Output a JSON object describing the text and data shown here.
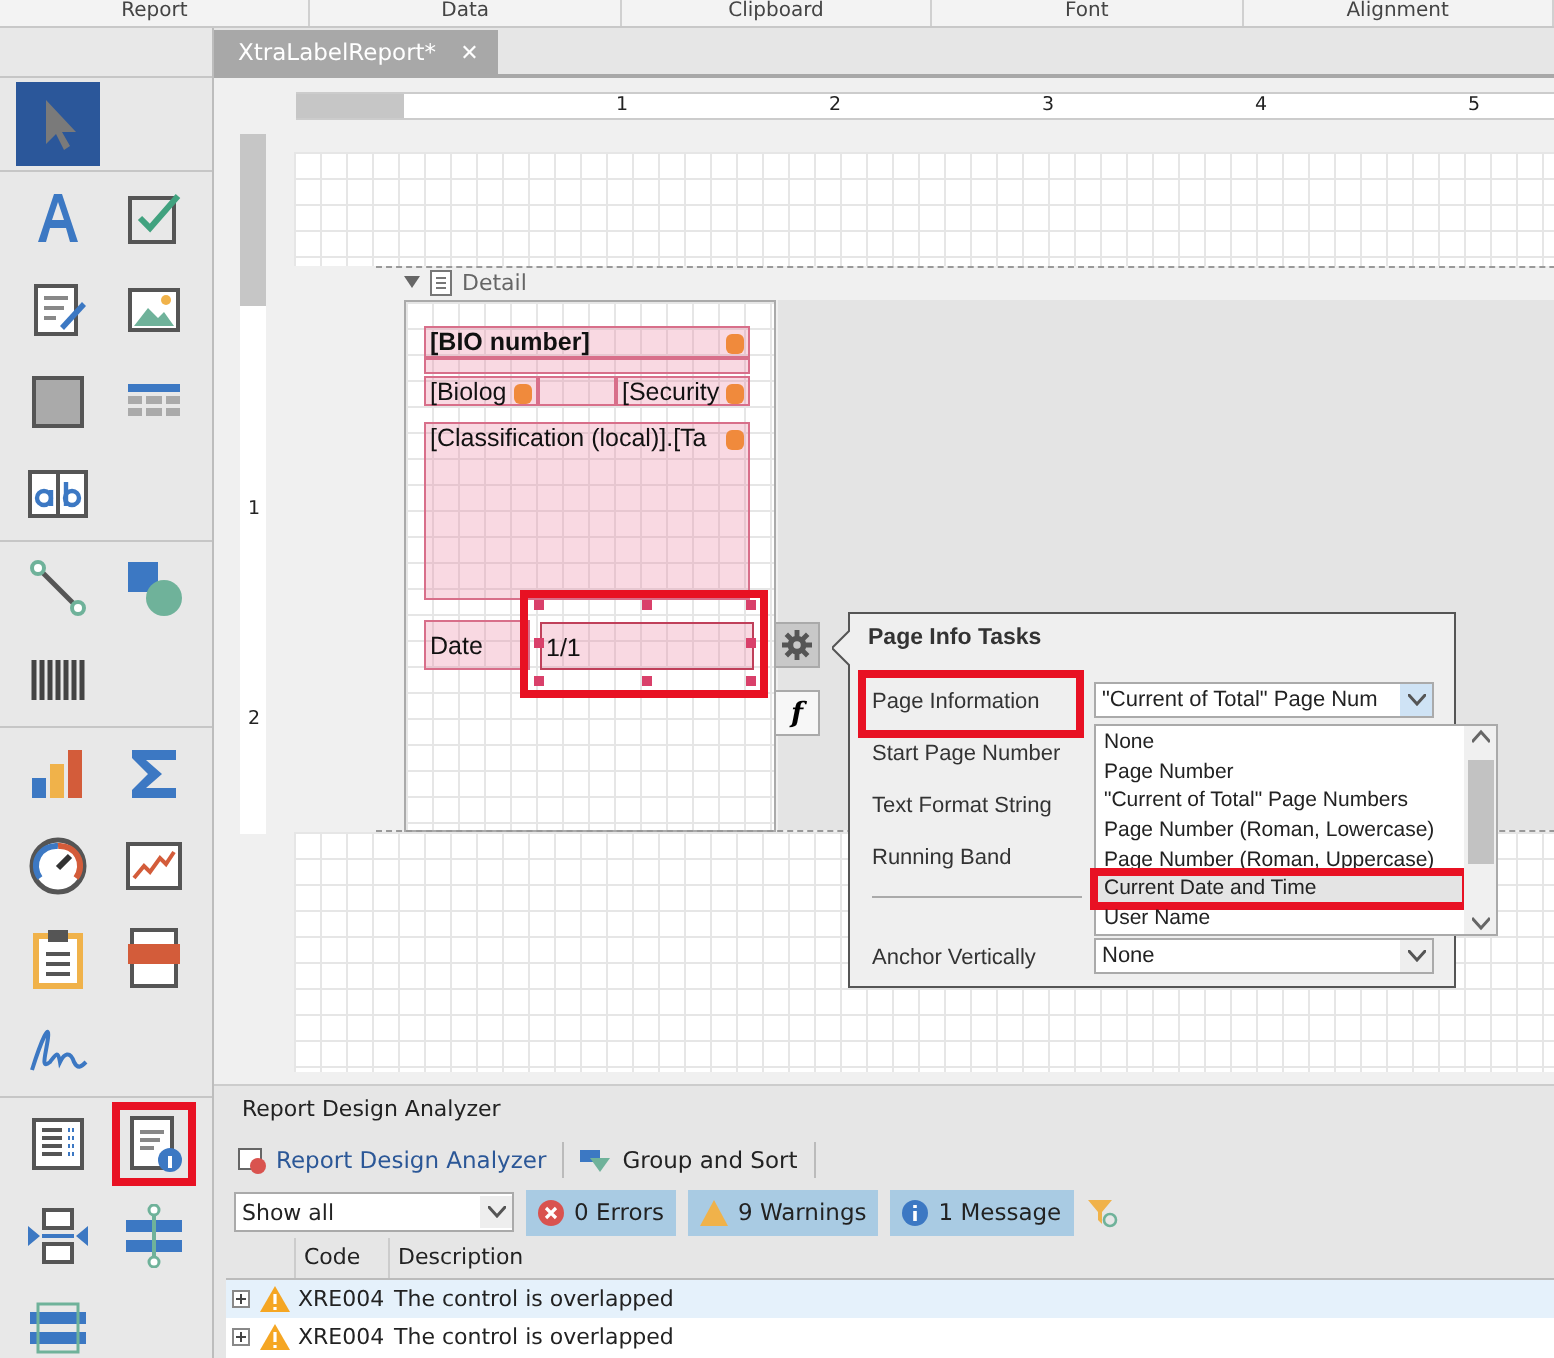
{
  "ribbon_groups": [
    "Report",
    "Data",
    "Clipboard",
    "Font",
    "Alignment"
  ],
  "document_tab": {
    "label": "XtraLabelReport*",
    "selected": true,
    "close_glyph": "✕"
  },
  "toolbox": [
    {
      "kind": "pointer",
      "selected": true,
      "highlighted": false
    },
    {
      "kind": "label",
      "selected": false,
      "highlighted": false
    },
    {
      "kind": "checkbox",
      "selected": false,
      "highlighted": false
    },
    {
      "kind": "richtext",
      "selected": false,
      "highlighted": false
    },
    {
      "kind": "picture",
      "selected": false,
      "highlighted": false
    },
    {
      "kind": "panel",
      "selected": false,
      "highlighted": false
    },
    {
      "kind": "table",
      "selected": false,
      "highlighted": false
    },
    {
      "kind": "comb",
      "selected": false,
      "highlighted": false
    },
    {
      "kind": "line",
      "selected": false,
      "highlighted": false
    },
    {
      "kind": "shape",
      "selected": false,
      "highlighted": false
    },
    {
      "kind": "barcode",
      "selected": false,
      "highlighted": false
    },
    {
      "kind": "chart",
      "selected": false,
      "highlighted": false
    },
    {
      "kind": "sum",
      "selected": false,
      "highlighted": false
    },
    {
      "kind": "gauge",
      "selected": false,
      "highlighted": false
    },
    {
      "kind": "sparkline",
      "selected": false,
      "highlighted": false
    },
    {
      "kind": "clipboard",
      "selected": false,
      "highlighted": false
    },
    {
      "kind": "pdf",
      "selected": false,
      "highlighted": false
    },
    {
      "kind": "signature",
      "selected": false,
      "highlighted": false
    },
    {
      "kind": "toc",
      "selected": false,
      "highlighted": false
    },
    {
      "kind": "pageinfo",
      "selected": false,
      "highlighted": true
    },
    {
      "kind": "pagebreak",
      "selected": false,
      "highlighted": false
    },
    {
      "kind": "crossline",
      "selected": false,
      "highlighted": false
    },
    {
      "kind": "crossband",
      "selected": false,
      "highlighted": false
    }
  ],
  "ruler": {
    "horizontal_marks": [
      "1",
      "2",
      "3",
      "4",
      "5"
    ],
    "vertical_marks": [
      "1",
      "2"
    ]
  },
  "band": {
    "title": "Detail",
    "expanded": true
  },
  "controls": [
    {
      "kind": "bold",
      "text": "[BIO number]",
      "bound": true,
      "selected": false
    },
    {
      "kind": "plain",
      "text": "[Biolog",
      "bound": true,
      "selected": false
    },
    {
      "kind": "plain",
      "text": "[Security",
      "bound": true,
      "selected": false
    },
    {
      "kind": "plain",
      "text": "[Classification (local)].[Ta",
      "bound": true,
      "selected": false
    },
    {
      "kind": "plain",
      "text": "Date",
      "bound": false,
      "selected": false
    },
    {
      "kind": "plain",
      "text": "1/1",
      "bound": false,
      "selected": true,
      "highlighted": true
    }
  ],
  "smart_tags": {
    "expression_glyph": "f"
  },
  "page_info_tasks": {
    "title": "Page Info Tasks",
    "properties": [
      {
        "label": "Page Information",
        "value": "\"Current of Total\" Page Num",
        "highlighted": true
      },
      {
        "label": "Start Page Number",
        "highlighted": false
      },
      {
        "label": "Text Format String",
        "highlighted": false
      },
      {
        "label": "Running Band",
        "highlighted": false
      },
      {
        "label": "Anchor Vertically",
        "value": "None",
        "highlighted": false
      }
    ],
    "options": [
      {
        "label": "None",
        "hovered": false,
        "highlighted": false
      },
      {
        "label": "Page Number",
        "hovered": false,
        "highlighted": false
      },
      {
        "label": "\"Current of Total\" Page Numbers",
        "hovered": false,
        "highlighted": false
      },
      {
        "label": "Page Number (Roman, Lowercase)",
        "hovered": false,
        "highlighted": false
      },
      {
        "label": "Page Number (Roman, Uppercase)",
        "hovered": false,
        "highlighted": false
      },
      {
        "label": "Current Date and Time",
        "hovered": true,
        "highlighted": true
      },
      {
        "label": "User Name",
        "hovered": false,
        "highlighted": false
      }
    ]
  },
  "analyzer": {
    "title": "Report Design Analyzer",
    "toolbar": [
      "Report Design Analyzer",
      "Group and Sort"
    ],
    "filter": {
      "value": "Show all"
    },
    "toggles": [
      {
        "kind": "error",
        "label": "0 Errors",
        "selected": true
      },
      {
        "kind": "warning",
        "label": "9 Warnings",
        "selected": true
      },
      {
        "kind": "info",
        "label": "1 Message",
        "selected": true
      }
    ],
    "columns": [
      "Code",
      "Description"
    ],
    "rows": [
      {
        "code": "XRE004",
        "description": "The control is overlapped",
        "selected": true
      },
      {
        "code": "XRE004",
        "description": "The control is overlapped",
        "selected": false
      }
    ]
  }
}
